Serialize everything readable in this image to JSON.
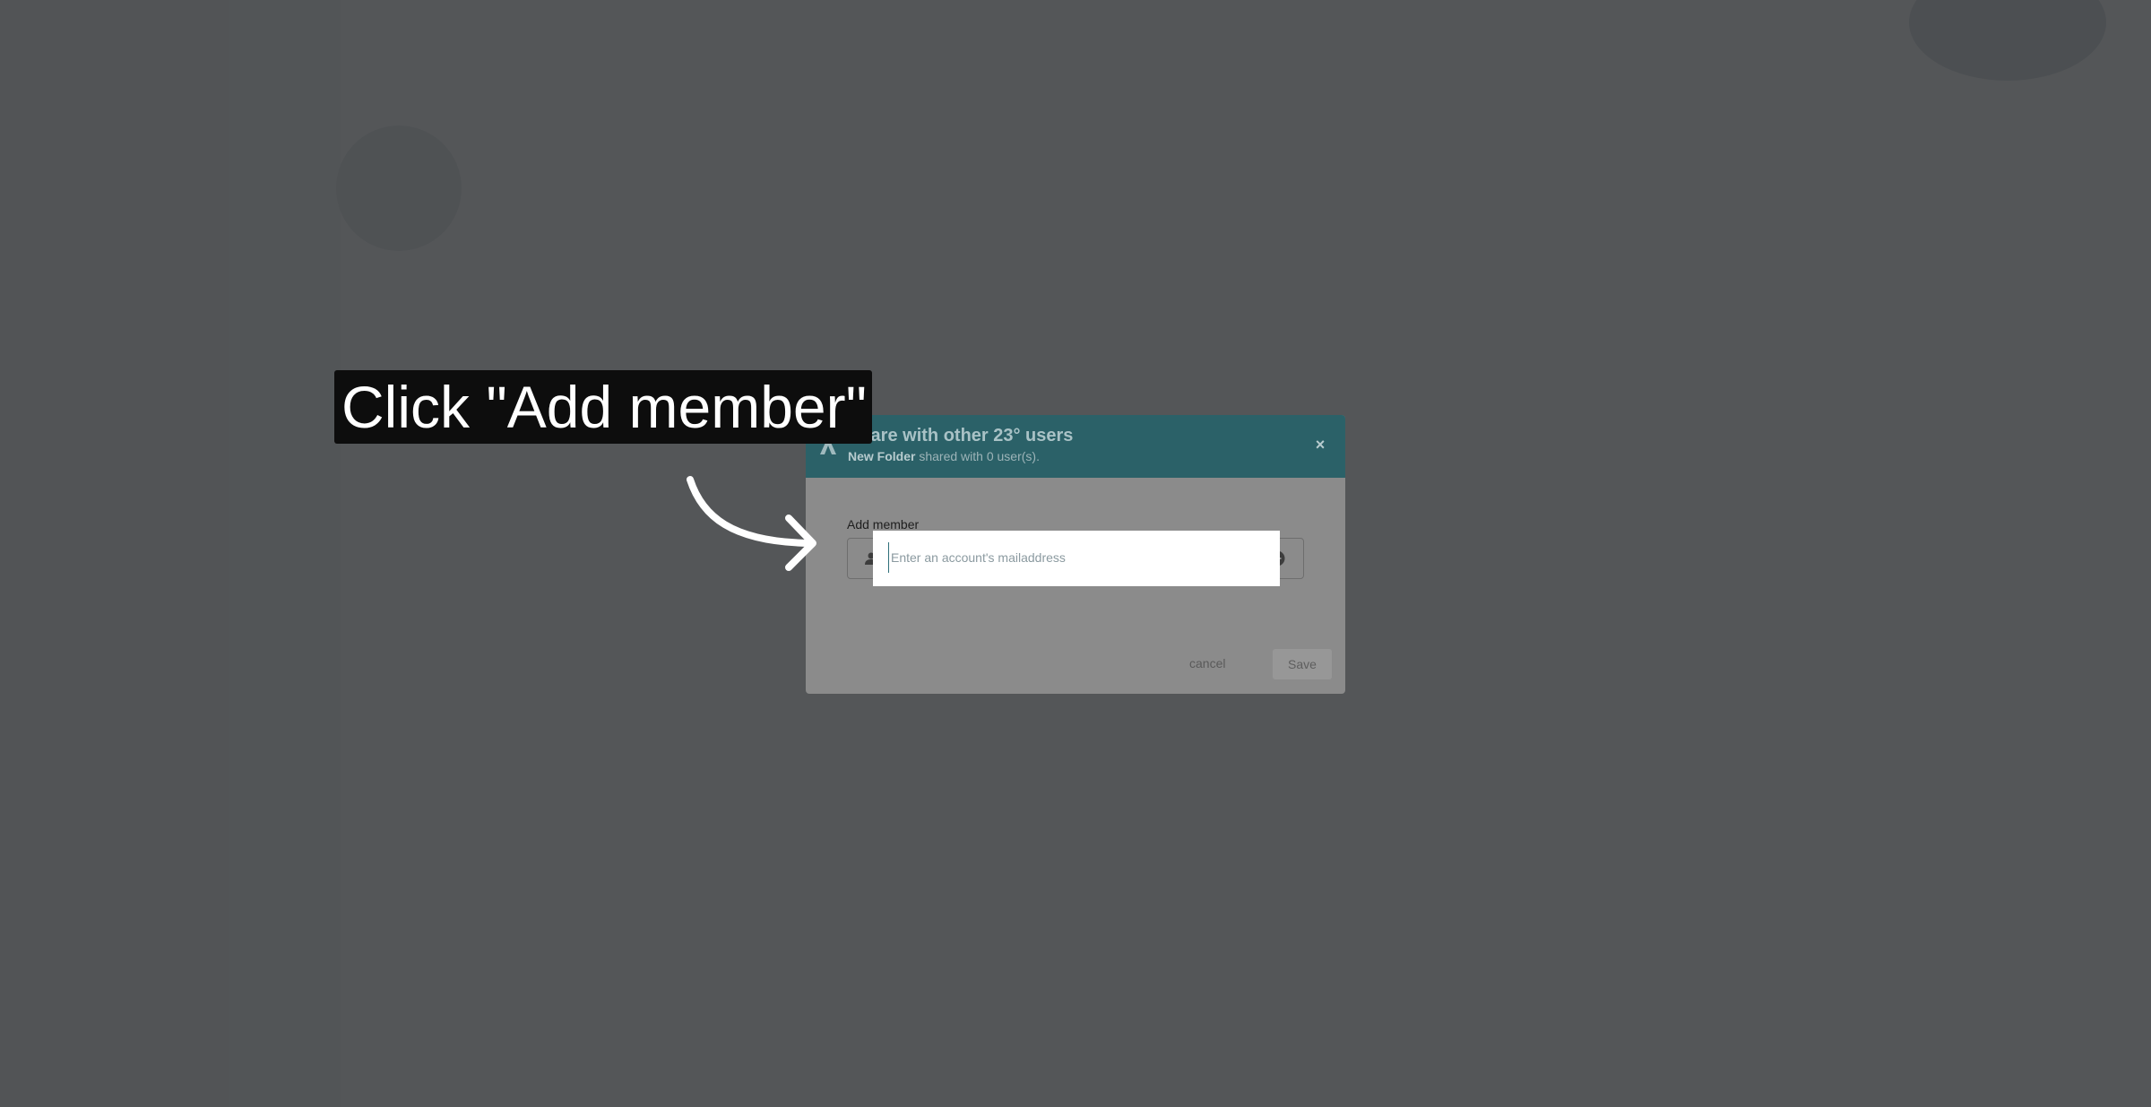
{
  "modal": {
    "title": "Share with other 23° users",
    "subtitle_folder": "New Folder",
    "subtitle_rest": " shared with 0 user(s).",
    "close_glyph": "×",
    "field_label": "Add member",
    "input_placeholder": "Enter an account's mailaddress",
    "input_value": "",
    "cancel_label": "cancel",
    "save_label": "Save"
  },
  "tutorial": {
    "callout_text": "Click \"Add member\""
  },
  "icons": {
    "logo": "app-logo-icon",
    "close": "close-icon",
    "user": "user-icon",
    "add": "add-circle-icon",
    "arrow": "curved-arrow-icon"
  },
  "colors": {
    "header": "#2b6168",
    "overlay": "#3c3e40",
    "callout_bg": "#0d0d0d",
    "callout_text": "#ffffff",
    "highlight": "#ffffff"
  }
}
